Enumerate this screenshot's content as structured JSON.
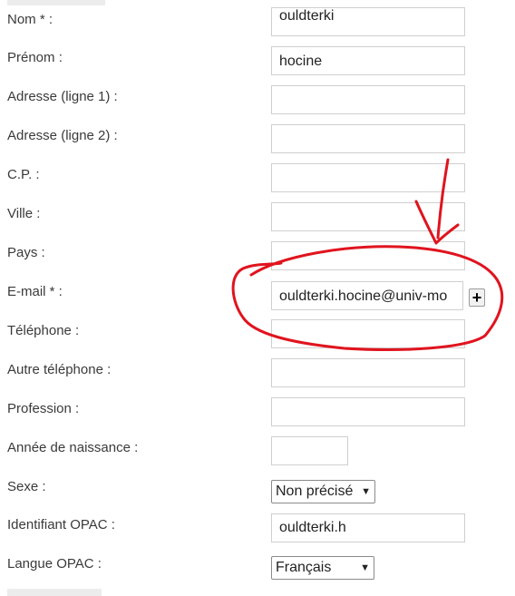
{
  "form": {
    "nom": {
      "label": "Nom * :",
      "value": "ouldterki"
    },
    "prenom": {
      "label": "Prénom :",
      "value": "hocine"
    },
    "adresse1": {
      "label": "Adresse (ligne 1) :",
      "value": ""
    },
    "adresse2": {
      "label": "Adresse (ligne 2) :",
      "value": ""
    },
    "cp": {
      "label": "C.P. :",
      "value": ""
    },
    "ville": {
      "label": "Ville :",
      "value": ""
    },
    "pays": {
      "label": "Pays :",
      "value": ""
    },
    "email": {
      "label": "E-mail * :",
      "value": "ouldterki.hocine@univ-mo",
      "add_button": "+"
    },
    "telephone": {
      "label": "Téléphone :",
      "value": ""
    },
    "autre_telephone": {
      "label": "Autre téléphone :",
      "value": ""
    },
    "profession": {
      "label": "Profession :",
      "value": ""
    },
    "annee_naissance": {
      "label": "Année de naissance :",
      "value": ""
    },
    "sexe": {
      "label": "Sexe :",
      "selected": "Non précisé"
    },
    "identifiant_opac": {
      "label": "Identifiant OPAC :",
      "value": "ouldterki.h"
    },
    "langue_opac": {
      "label": "Langue OPAC :",
      "selected": "Français"
    }
  },
  "annotation": {
    "color": "#e0141e",
    "shapes": [
      "arrow",
      "circle"
    ]
  }
}
